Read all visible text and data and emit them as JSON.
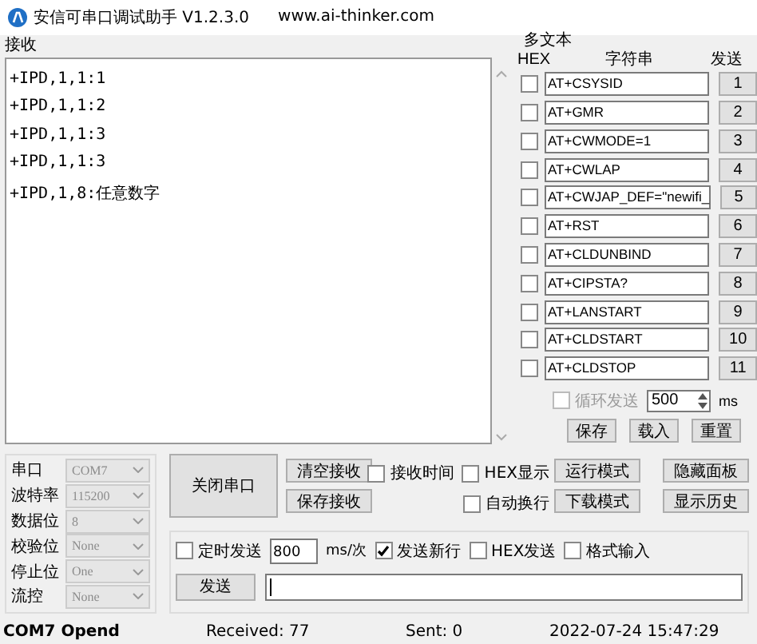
{
  "window": {
    "title": "安信可串口调试助手 V1.2.3.0",
    "website": "www.ai-thinker.com"
  },
  "receive": {
    "label": "接收",
    "lines": [
      "+IPD,1,1:1",
      "+IPD,1,1:2",
      "+IPD,1,1:3",
      "+IPD,1,1:3",
      "+IPD,1,8:任意数字"
    ]
  },
  "multi_text": {
    "label": "多文本",
    "columns": [
      "HEX",
      "字符串",
      "发送"
    ],
    "rows": [
      {
        "checked": false,
        "value": "AT+CSYSID",
        "button": "1"
      },
      {
        "checked": false,
        "value": "AT+GMR",
        "button": "2"
      },
      {
        "checked": false,
        "value": "AT+CWMODE=1",
        "button": "3"
      },
      {
        "checked": false,
        "value": "AT+CWLAP",
        "button": "4"
      },
      {
        "checked": false,
        "value": "AT+CWJAP_DEF=\"newifi_",
        "button": "5"
      },
      {
        "checked": false,
        "value": "AT+RST",
        "button": "6"
      },
      {
        "checked": false,
        "value": "AT+CLDUNBIND",
        "button": "7"
      },
      {
        "checked": false,
        "value": "AT+CIPSTA?",
        "button": "8"
      },
      {
        "checked": false,
        "value": "AT+LANSTART",
        "button": "9"
      },
      {
        "checked": false,
        "value": "AT+CLDSTART",
        "button": "10"
      },
      {
        "checked": false,
        "value": "AT+CLDSTOP",
        "button": "11"
      }
    ],
    "loop": {
      "label": "循环发送",
      "checked": false,
      "disabled": true,
      "value": "500",
      "unit": "ms"
    },
    "buttons": [
      "保存",
      "载入",
      "重置"
    ]
  },
  "serial": {
    "fields": [
      {
        "label": "串口",
        "value": "COM7",
        "disabled": true
      },
      {
        "label": "波特率",
        "value": "115200",
        "disabled": true
      },
      {
        "label": "数据位",
        "value": "8",
        "disabled": true
      },
      {
        "label": "校验位",
        "value": "None",
        "disabled": true
      },
      {
        "label": "停止位",
        "value": "One",
        "disabled": true
      },
      {
        "label": "流控",
        "value": "None",
        "disabled": true
      }
    ],
    "open_button": "关闭串口"
  },
  "receive_buttons": [
    "清空接收",
    "保存接收"
  ],
  "receive_options": [
    {
      "label": "接收时间",
      "checked": false
    },
    {
      "label": "HEX显示",
      "checked": false
    },
    {
      "label": "自动换行",
      "checked": false
    }
  ],
  "mode_buttons": [
    "运行模式",
    "下载模式"
  ],
  "panel_buttons": [
    "隐藏面板",
    "显示历史"
  ],
  "send": {
    "timer": {
      "label": "定时发送",
      "checked": false
    },
    "interval": "800",
    "unit": "ms/次",
    "options": [
      {
        "label": "发送新行",
        "checked": true
      },
      {
        "label": "HEX发送",
        "checked": false
      },
      {
        "label": "格式输入",
        "checked": false
      }
    ],
    "button": "发送"
  },
  "status_bar": [
    "COM7 Opend",
    "Received: 77",
    "Sent: 0",
    "2022-07-24 15:47:29"
  ]
}
